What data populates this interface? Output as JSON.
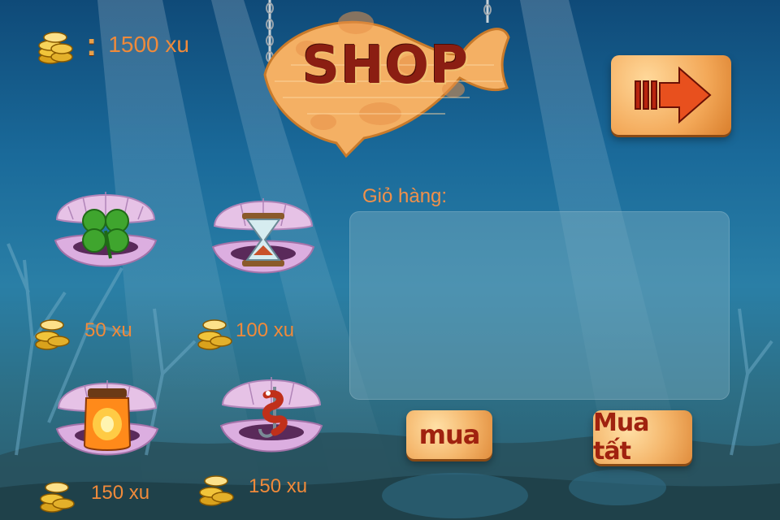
{
  "balance": {
    "separator": ":",
    "amount": "1500 xu"
  },
  "sign": {
    "title": "SHOP"
  },
  "cart": {
    "label": "Giỏ hàng:"
  },
  "buttons": {
    "buy": "mua",
    "buy_all": "Mua tất",
    "next": "arrow-right-icon"
  },
  "items": [
    {
      "icon": "four-leaf-clover-icon",
      "price": "50 xu"
    },
    {
      "icon": "hourglass-icon",
      "price": "100 xu"
    },
    {
      "icon": "glowing-jar-icon",
      "price": "150 xu"
    },
    {
      "icon": "worm-on-hook-icon",
      "price": "150 xu"
    }
  ],
  "colors": {
    "price_text": "#f08a3a",
    "button_text": "#a0220f",
    "wood": "#f4b56a"
  }
}
